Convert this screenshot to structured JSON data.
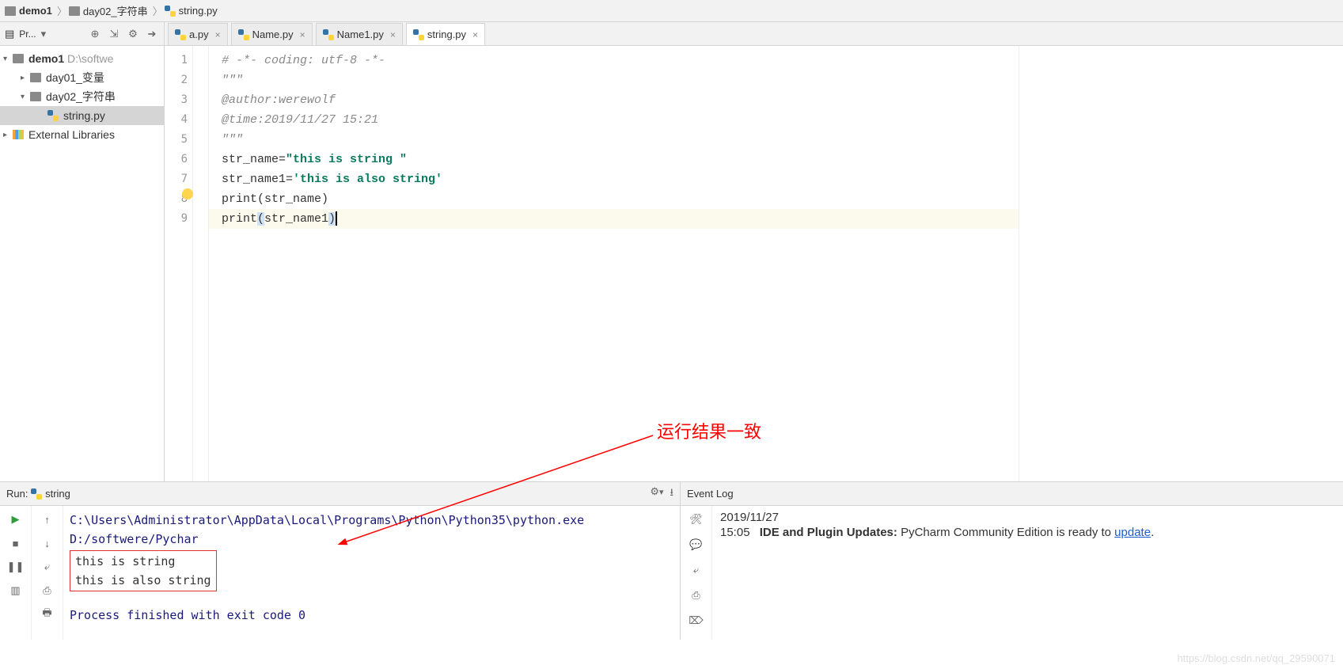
{
  "breadcrumb": [
    {
      "label": "demo1",
      "icon": "folder",
      "bold": true
    },
    {
      "label": "day02_字符串",
      "icon": "folder",
      "bold": false
    },
    {
      "label": "string.py",
      "icon": "py",
      "bold": false
    }
  ],
  "sidebar": {
    "toolbar_label": "Pr...",
    "tree": [
      {
        "label": "demo1",
        "path": "D:\\softwe",
        "icon": "folder",
        "depth": 0,
        "arrow": "▾",
        "bold": true
      },
      {
        "label": "day01_变量",
        "icon": "folder",
        "depth": 1,
        "arrow": "▸"
      },
      {
        "label": "day02_字符串",
        "icon": "folder",
        "depth": 1,
        "arrow": "▾"
      },
      {
        "label": "string.py",
        "icon": "py",
        "depth": 2,
        "sel": true
      },
      {
        "label": "External Libraries",
        "icon": "lib",
        "depth": 0,
        "arrow": "▸"
      }
    ]
  },
  "tabs": [
    {
      "label": "a.py",
      "icon": "py",
      "active": false
    },
    {
      "label": "Name.py",
      "icon": "py",
      "active": false
    },
    {
      "label": "Name1.py",
      "icon": "py",
      "active": false
    },
    {
      "label": "string.py",
      "icon": "py",
      "active": true
    }
  ],
  "code": {
    "lines": [
      {
        "n": 1,
        "html": "<span class='comment'># -*- coding: utf-8 -*-</span>"
      },
      {
        "n": 2,
        "html": "<span class='comment'>\"\"\"</span>"
      },
      {
        "n": 3,
        "html": "<span class='comment'>@author:werewolf</span>"
      },
      {
        "n": 4,
        "html": "<span class='comment'>@time:2019/11/27 15:21</span>"
      },
      {
        "n": 5,
        "html": "<span class='comment'>\"\"\"</span>"
      },
      {
        "n": 6,
        "html": "<span class='ident'>str_name</span>=<span class='string'>\"this is string \"</span>"
      },
      {
        "n": 7,
        "html": "<span class='ident'>str_name1</span>=<span class='string'>'this is also string'</span>"
      },
      {
        "n": 8,
        "html": "<span class='func'>print</span><span class='paren'>(</span><span class='ident'>str_name</span><span class='paren'>)</span>"
      },
      {
        "n": 9,
        "cur": true,
        "html": "<span class='func'>print</span><span class='paren sel-hl'>(</span><span class='ident'>str_name1</span><span class='paren sel-hl'>)</span><span class='caret'></span>"
      }
    ]
  },
  "run": {
    "title": "Run:",
    "name": "string",
    "cmd": "C:\\Users\\Administrator\\AppData\\Local\\Programs\\Python\\Python35\\python.exe D:/softwere/Pychar",
    "output": [
      "this is string",
      "this is also string"
    ],
    "exit": "Process finished with exit code 0"
  },
  "eventlog": {
    "title": "Event Log",
    "date": "2019/11/27",
    "time": "15:05",
    "msg_bold": "IDE and Plugin Updates:",
    "msg_rest": " PyCharm Community Edition is ready to ",
    "link": "update"
  },
  "annotation": "运行结果一致",
  "watermark": "https://blog.csdn.net/qq_29590071"
}
